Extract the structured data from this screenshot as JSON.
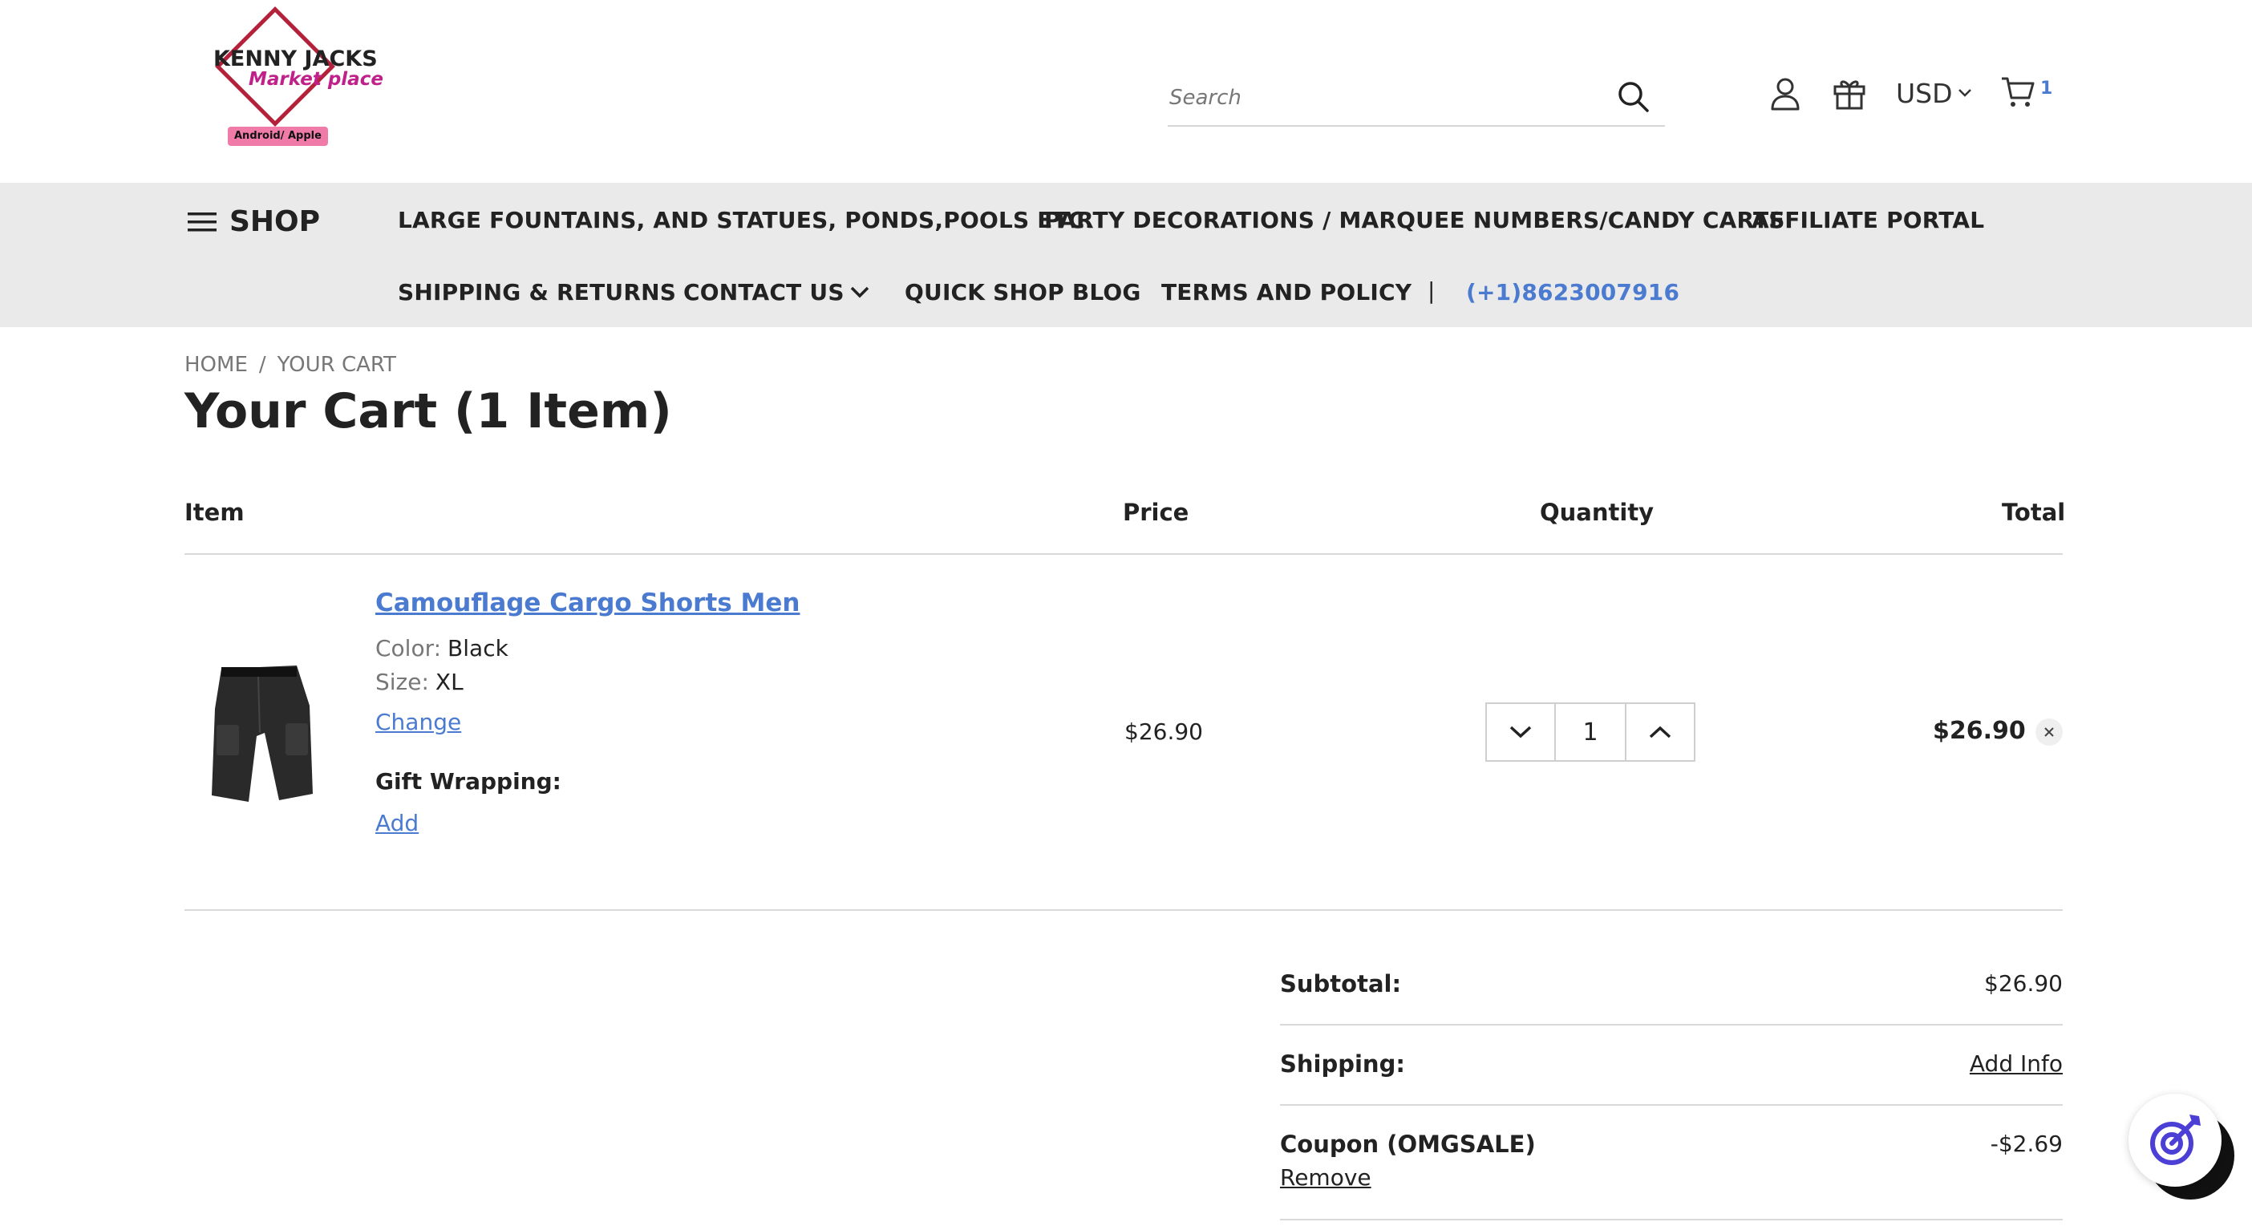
{
  "header": {
    "logo": {
      "line1": "KENNY JACKS",
      "line2": "Market place",
      "tag": "Android/ Apple"
    },
    "search_placeholder": "Search",
    "currency": "USD",
    "cart_count": "1"
  },
  "nav": {
    "shop_label": "SHOP",
    "items": [
      "LARGE FOUNTAINS, AND STATUES, PONDS,POOLS ETC.",
      "PARTY DECORATIONS / MARQUEE NUMBERS/CANDY CARTS",
      "AFFILIATE PORTAL",
      "SHIPPING & RETURNS",
      "CONTACT US",
      "QUICK SHOP BLOG",
      "TERMS AND POLICY"
    ],
    "separator": "|",
    "phone": "(+1)8623007916"
  },
  "breadcrumb": {
    "home": "HOME",
    "separator": "/",
    "current": "YOUR CART"
  },
  "page_title": "Your Cart (1 Item)",
  "table": {
    "headers": {
      "item": "Item",
      "price": "Price",
      "quantity": "Quantity",
      "total": "Total"
    },
    "row": {
      "name": "Camouflage Cargo Shorts Men",
      "color_label": "Color:",
      "color_value": "Black",
      "size_label": "Size:",
      "size_value": "XL",
      "change_label": "Change",
      "gift_wrapping_label": "Gift Wrapping:",
      "gift_add_label": "Add",
      "price": "$26.90",
      "quantity": "1",
      "total": "$26.90"
    }
  },
  "totals": {
    "subtotal_label": "Subtotal:",
    "subtotal_value": "$26.90",
    "shipping_label": "Shipping:",
    "shipping_action": "Add Info",
    "coupon_label": "Coupon (OMGSALE)",
    "coupon_value": "-$2.69",
    "coupon_remove": "Remove"
  },
  "colors": {
    "link": "#4a7bd0",
    "nav_bg": "#eaeaea",
    "text": "#222222",
    "logo_red": "#b3223a",
    "logo_pink": "#c0208a",
    "widget_accent": "#4b3fd6"
  },
  "icons": [
    "hamburger-icon",
    "search-icon",
    "user-icon",
    "gift-icon",
    "chevron-down-icon",
    "cart-icon",
    "chevron-up-icon",
    "close-icon",
    "target-icon"
  ]
}
